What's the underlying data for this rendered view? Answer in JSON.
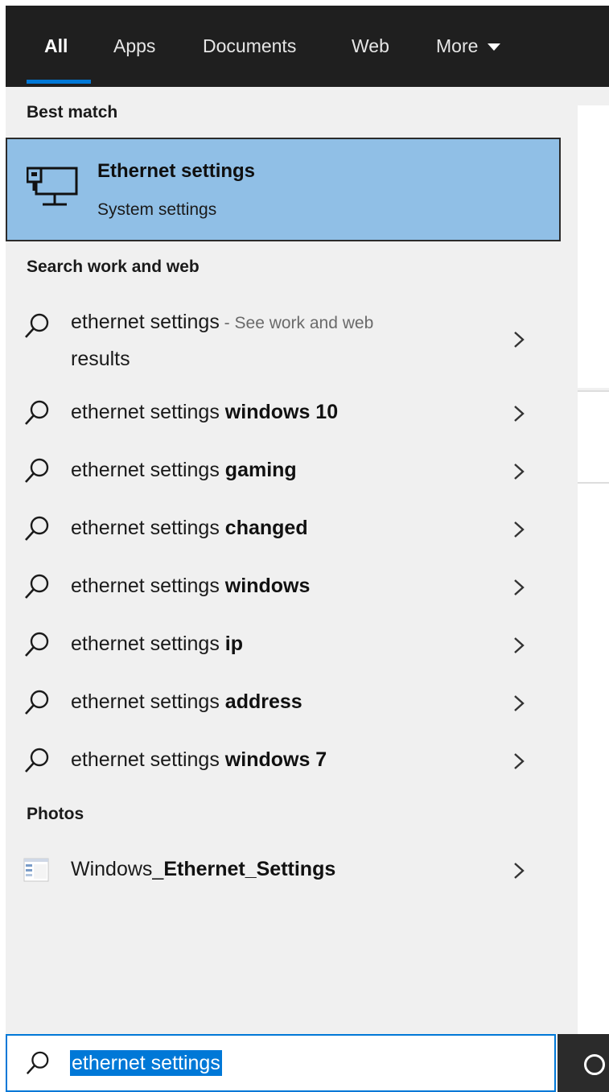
{
  "tabs": [
    {
      "label": "All"
    },
    {
      "label": "Apps"
    },
    {
      "label": "Documents"
    },
    {
      "label": "Web"
    },
    {
      "label": "More"
    }
  ],
  "best_match": {
    "header": "Best match",
    "title": "Ethernet settings",
    "subtitle": "System settings",
    "icon": "ethernet-monitor-icon"
  },
  "work_web": {
    "header": "Search work and web",
    "items": [
      {
        "prefix": "ethernet settings",
        "bold": "",
        "suffix": " - See work and web",
        "suffix2": "results"
      },
      {
        "prefix": "ethernet settings ",
        "bold": "windows 10"
      },
      {
        "prefix": "ethernet settings ",
        "bold": "gaming"
      },
      {
        "prefix": "ethernet settings ",
        "bold": "changed"
      },
      {
        "prefix": "ethernet settings ",
        "bold": "windows"
      },
      {
        "prefix": "ethernet settings ",
        "bold": "ip"
      },
      {
        "prefix": "ethernet settings ",
        "bold": "address"
      },
      {
        "prefix": "ethernet settings ",
        "bold": "windows 7"
      }
    ]
  },
  "photos": {
    "header": "Photos",
    "items": [
      {
        "prefix": "Windows_",
        "bold": "Ethernet_Settings"
      }
    ]
  },
  "search": {
    "value": "ethernet settings"
  },
  "colors": {
    "tabbar_bg": "#1f1f1f",
    "accent": "#0078d7",
    "best_match_bg": "#90bfe6",
    "panel_bg": "#f0f0f0"
  }
}
